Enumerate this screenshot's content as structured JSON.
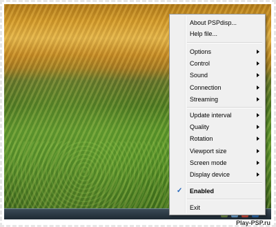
{
  "menu": {
    "about_label": "About PSPdisp...",
    "help_label": "Help file...",
    "options_label": "Options",
    "control_label": "Control",
    "sound_label": "Sound",
    "connection_label": "Connection",
    "streaming_label": "Streaming",
    "update_interval_label": "Update interval",
    "quality_label": "Quality",
    "rotation_label": "Rotation",
    "viewport_size_label": "Viewport size",
    "screen_mode_label": "Screen mode",
    "display_device_label": "Display device",
    "enabled_label": "Enabled",
    "enabled_checked_glyph": "✓",
    "exit_label": "Exit"
  },
  "watermark": {
    "text": "Play-PSP.ru"
  },
  "colors": {
    "menu_bg": "#f0f0f0",
    "checkmark": "#1c5fb8",
    "taskbar": "#1e2a33"
  }
}
